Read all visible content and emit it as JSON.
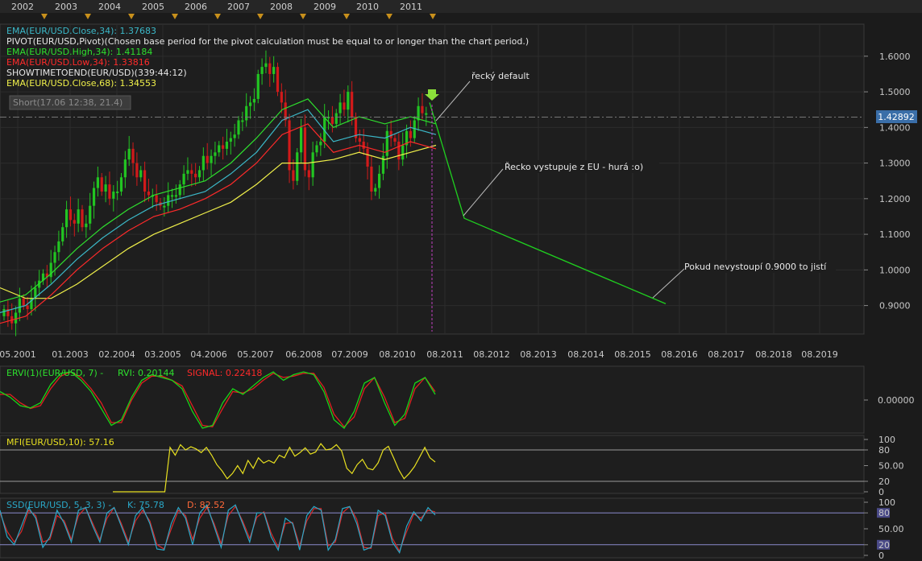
{
  "colors": {
    "background": "#1b1b1b",
    "plot_bg": "#1e1e1e",
    "grid": "#2c2c2c",
    "axis_text": "#c8c8c8",
    "candle_up": "#22c522",
    "candle_down": "#d11a1a",
    "ema_close34": "#3bb8c8",
    "ema_high34": "#2ee02e",
    "ema_low34": "#ff2a2a",
    "ema_close68": "#f0f04a",
    "projection": "#1fd01f",
    "price_marker_bg": "#3a6ea8",
    "vertical_marker": "#c040c0",
    "ervi_green": "#18d418",
    "ervi_red": "#e02020",
    "mfi_line": "#e8e020",
    "ssd_k": "#2aa8c8",
    "ssd_d": "#d82a2a",
    "level_line": "#8a8acc"
  },
  "timeline": {
    "years": [
      "2002",
      "2003",
      "2004",
      "2005",
      "2006",
      "2007",
      "2008",
      "2009",
      "2010",
      "2011"
    ]
  },
  "main_legend": [
    {
      "text": "EMA(EUR/USD.Close,34): 1.37683",
      "color": "#3bb8c8"
    },
    {
      "text": "PIVOT(EUR/USD,Pivot)(Chosen base period for the pivot calculation must be equal to or longer than the chart period.)",
      "color": "#e6e6e6"
    },
    {
      "text": "EMA(EUR/USD.High,34): 1.41184",
      "color": "#2ee02e"
    },
    {
      "text": "EMA(EUR/USD.Low,34): 1.33816",
      "color": "#ff2a2a"
    },
    {
      "text": "SHOWTIMETOEND(EUR/USD)(339:44:12)",
      "color": "#e6e6e6"
    },
    {
      "text": "EMA(EUR/USD.Close,68): 1.34553",
      "color": "#f0f04a"
    }
  ],
  "short_badge": "Short(17.06 12:38, 21.4)",
  "price_marker": "1.42892",
  "annotations": {
    "greek_default": "řecký default",
    "greece_exit": "Řecko vystupuje z EU - hurá :o)",
    "support_note": "Pokud nevystoupí 0.9000 to jistí"
  },
  "chart_data": [
    {
      "type": "candlestick",
      "title": "",
      "instrument": "EUR/USD",
      "xlabel": "",
      "ylabel": "",
      "x_ticks": [
        "05.2001",
        "01.2003",
        "02.2004",
        "03.2005",
        "04.2006",
        "05.2007",
        "06.2008",
        "07.2009",
        "08.2010",
        "08.2011",
        "08.2012",
        "08.2013",
        "08.2014",
        "08.2015",
        "08.2016",
        "08.2017",
        "08.2018",
        "08.2019"
      ],
      "y_ticks": [
        "0.9000",
        "1.0000",
        "1.1000",
        "1.2000",
        "1.3000",
        "1.4000",
        "1.5000",
        "1.6000"
      ],
      "ylim": [
        0.82,
        1.69
      ],
      "grid": true,
      "close_series": [
        0.89,
        0.87,
        0.85,
        0.88,
        0.92,
        0.9,
        0.89,
        0.92,
        0.95,
        0.97,
        0.99,
        0.98,
        1.02,
        1.05,
        1.08,
        1.12,
        1.17,
        1.14,
        1.13,
        1.17,
        1.12,
        1.13,
        1.18,
        1.23,
        1.26,
        1.22,
        1.24,
        1.2,
        1.22,
        1.22,
        1.26,
        1.31,
        1.34,
        1.3,
        1.26,
        1.28,
        1.22,
        1.21,
        1.21,
        1.19,
        1.18,
        1.18,
        1.21,
        1.21,
        1.21,
        1.24,
        1.27,
        1.28,
        1.27,
        1.26,
        1.28,
        1.32,
        1.3,
        1.32,
        1.33,
        1.35,
        1.34,
        1.36,
        1.37,
        1.38,
        1.42,
        1.42,
        1.46,
        1.47,
        1.48,
        1.55,
        1.57,
        1.58,
        1.55,
        1.57,
        1.5,
        1.47,
        1.42,
        1.28,
        1.25,
        1.33,
        1.4,
        1.28,
        1.26,
        1.33,
        1.35,
        1.36,
        1.43,
        1.43,
        1.41,
        1.44,
        1.47,
        1.45,
        1.5,
        1.43,
        1.37,
        1.36,
        1.34,
        1.29,
        1.22,
        1.23,
        1.27,
        1.32,
        1.39,
        1.37,
        1.36,
        1.31,
        1.35,
        1.39,
        1.37,
        1.42,
        1.46,
        1.44,
        1.44
      ],
      "ema_close34": [
        0.88,
        0.9,
        0.96,
        1.03,
        1.09,
        1.14,
        1.18,
        1.2,
        1.22,
        1.27,
        1.33,
        1.42,
        1.45,
        1.36,
        1.38,
        1.37,
        1.4,
        1.38
      ],
      "ema_high34": [
        0.91,
        0.93,
        0.99,
        1.06,
        1.12,
        1.17,
        1.21,
        1.23,
        1.25,
        1.3,
        1.37,
        1.45,
        1.48,
        1.4,
        1.43,
        1.41,
        1.43,
        1.41
      ],
      "ema_low34": [
        0.85,
        0.87,
        0.93,
        1.0,
        1.06,
        1.11,
        1.15,
        1.17,
        1.2,
        1.24,
        1.3,
        1.38,
        1.41,
        1.33,
        1.35,
        1.33,
        1.36,
        1.34
      ],
      "ema_close68": [
        0.95,
        0.92,
        0.92,
        0.96,
        1.01,
        1.06,
        1.1,
        1.13,
        1.16,
        1.19,
        1.24,
        1.3,
        1.3,
        1.31,
        1.33,
        1.31,
        1.33,
        1.35
      ],
      "projection": [
        {
          "x": "07.2011",
          "y": 1.47
        },
        {
          "x": "04.2012",
          "y": 1.145
        },
        {
          "x": "09.2015",
          "y": 0.905
        }
      ]
    },
    {
      "type": "line",
      "title": "ERVI(1)(EUR/USD, 7)",
      "legend": [
        "ERVI(1)(EUR/USD, 7) -",
        "RVI: 0.20144",
        "SIGNAL: 0.22418"
      ],
      "y_ticks": [
        "0.00000"
      ],
      "rvi": [
        0.3,
        0.1,
        -0.2,
        -0.28,
        -0.1,
        0.55,
        0.95,
        1.0,
        0.7,
        0.3,
        -0.3,
        -0.9,
        -0.7,
        0.1,
        0.7,
        0.9,
        0.8,
        0.7,
        0.4,
        -0.4,
        -1.0,
        -0.9,
        -0.1,
        0.4,
        0.2,
        0.5,
        0.8,
        1.0,
        0.7,
        0.9,
        1.0,
        0.9,
        0.3,
        -0.7,
        -1.0,
        -0.4,
        0.6,
        0.8,
        -0.1,
        -0.9,
        -0.5,
        0.6,
        0.8,
        0.2
      ],
      "signal": [
        0.2,
        0.2,
        -0.1,
        -0.3,
        -0.2,
        0.4,
        0.85,
        1.0,
        0.8,
        0.4,
        -0.1,
        -0.8,
        -0.8,
        0.0,
        0.6,
        0.85,
        0.85,
        0.7,
        0.5,
        -0.2,
        -0.9,
        -0.95,
        -0.3,
        0.3,
        0.25,
        0.4,
        0.7,
        0.95,
        0.8,
        0.85,
        0.95,
        0.95,
        0.45,
        -0.5,
        -0.95,
        -0.6,
        0.4,
        0.8,
        0.1,
        -0.8,
        -0.65,
        0.4,
        0.8,
        0.3
      ]
    },
    {
      "type": "line",
      "title": "MFI(EUR/USD,10)",
      "legend": [
        "MFI(EUR/USD,10): 57.16"
      ],
      "y_ticks": [
        "100",
        "80",
        "50.00",
        "20",
        "0"
      ],
      "ylim": [
        0,
        100
      ],
      "levels": [
        20,
        80
      ],
      "mfi": [
        0,
        0,
        0,
        0,
        0,
        0,
        0,
        0,
        0,
        0,
        0,
        85,
        70,
        90,
        80,
        86,
        82,
        75,
        85,
        70,
        52,
        40,
        25,
        35,
        50,
        35,
        60,
        45,
        65,
        55,
        60,
        55,
        70,
        65,
        85,
        68,
        75,
        84,
        72,
        76,
        92,
        80,
        82,
        90,
        78,
        45,
        35,
        52,
        62,
        45,
        42,
        55,
        80,
        87,
        65,
        42,
        25,
        35,
        48,
        66,
        85,
        65,
        57
      ]
    },
    {
      "type": "line",
      "title": "SSD(EUR/USD, 5, 3, 3)",
      "legend": [
        "SSD(EUR/USD, 5, 3, 3) -",
        "K: 75.78",
        "D: 82.52"
      ],
      "y_ticks": [
        "100",
        "80",
        "50.00",
        "20",
        "0"
      ],
      "ylim": [
        0,
        100
      ],
      "levels": [
        20,
        80
      ],
      "k": [
        85,
        35,
        20,
        55,
        90,
        70,
        15,
        35,
        85,
        60,
        25,
        85,
        90,
        55,
        25,
        80,
        90,
        55,
        20,
        75,
        90,
        60,
        12,
        10,
        60,
        90,
        70,
        20,
        80,
        95,
        55,
        15,
        85,
        95,
        60,
        25,
        80,
        80,
        35,
        10,
        70,
        60,
        10,
        75,
        92,
        85,
        10,
        30,
        88,
        92,
        60,
        10,
        15,
        85,
        75,
        25,
        5,
        55,
        82,
        65,
        90,
        76
      ],
      "d": [
        80,
        45,
        25,
        45,
        85,
        75,
        25,
        30,
        75,
        65,
        30,
        75,
        90,
        60,
        30,
        70,
        90,
        60,
        25,
        65,
        85,
        65,
        20,
        12,
        50,
        85,
        75,
        30,
        70,
        90,
        60,
        22,
        75,
        92,
        65,
        32,
        72,
        82,
        42,
        15,
        60,
        62,
        18,
        65,
        88,
        88,
        18,
        25,
        80,
        92,
        68,
        15,
        13,
        75,
        80,
        32,
        8,
        45,
        78,
        70,
        85,
        82
      ]
    }
  ]
}
